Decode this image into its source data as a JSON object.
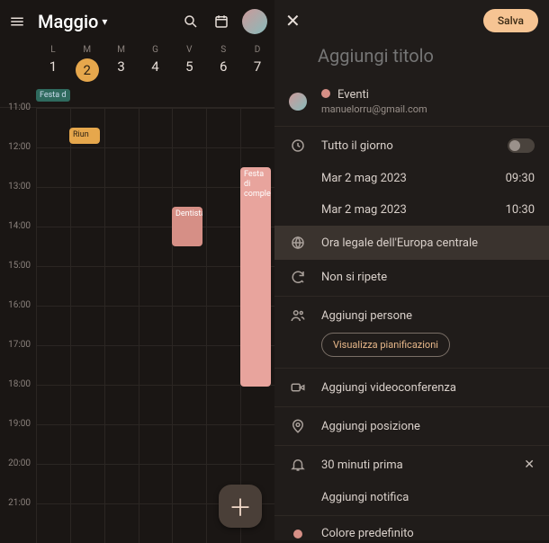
{
  "header": {
    "month_label": "Maggio"
  },
  "days": {
    "letters": [
      "L",
      "M",
      "M",
      "G",
      "V",
      "S",
      "D"
    ],
    "numbers": [
      "1",
      "2",
      "3",
      "4",
      "5",
      "6",
      "7"
    ],
    "selected_index": 1
  },
  "allday": {
    "label": "Festa d"
  },
  "hours": [
    "11:00",
    "12:00",
    "13:00",
    "14:00",
    "15:00",
    "16:00",
    "17:00",
    "18:00",
    "19:00",
    "20:00",
    "21:00"
  ],
  "events": {
    "riun": "Riun",
    "dent": "Dentista",
    "festa": "Festa di compleanno"
  },
  "editor": {
    "save": "Salva",
    "title_placeholder": "Aggiungi titolo",
    "calendar_name": "Eventi",
    "calendar_email": "manuelorru@gmail.com",
    "allday_label": "Tutto il giorno",
    "start_date": "Mar 2 mag 2023",
    "start_time": "09:30",
    "end_date": "Mar 2 mag 2023",
    "end_time": "10:30",
    "timezone": "Ora legale dell'Europa centrale",
    "repeat": "Non si ripete",
    "add_people": "Aggiungi persone",
    "view_schedules": "Visualizza pianificazioni",
    "add_video": "Aggiungi videoconferenza",
    "add_location": "Aggiungi posizione",
    "reminder": "30 minuti prima",
    "add_reminder": "Aggiungi notifica",
    "color": "Colore predefinito"
  }
}
